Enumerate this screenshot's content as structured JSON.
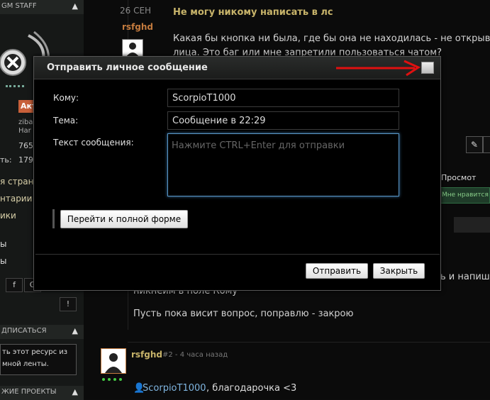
{
  "sidebar": {
    "header1": "GM STAFF",
    "user_short1": "ziba",
    "user_short2": "Har",
    "stat1": "765",
    "stat_label": "ть:",
    "stat2": "179",
    "badge": "Акт",
    "links": [
      "я страниц",
      "нтарии п",
      "ики",
      "ы",
      "ы"
    ],
    "subscribe_header": "ДПИСАТЬСЯ",
    "subscribe_line1": "ть этот ресурс из",
    "subscribe_line2": "мной ленты.",
    "projects_header": "ЖИЕ ПРОЕКТЫ",
    "social": [
      "f",
      "G",
      "●"
    ],
    "excl": "!"
  },
  "post1": {
    "date": "26 СЕН",
    "author": "rsfghd",
    "title": "Не могу никому написать в лс",
    "line1": "Какая бы кнопка ни была, где бы она не находилась - не открывае",
    "line2": "лица. Это баг или мне запретили пользоваться чатом?"
  },
  "post_bg": {
    "right_text": "ь и напиш",
    "text1": "никнеим в поле Кому",
    "text2": "Пусть пока висит вопрос, поправлю - закрою",
    "views_label": "Просмот",
    "likes_label": "Мне нравится +"
  },
  "post2": {
    "author": "rsfghd",
    "meta": "#2 - 4 часа назад",
    "mention": "ScorpioT1000",
    "reply": ", благодарочка <3"
  },
  "dialog": {
    "title": "Отправить личное сообщение",
    "to_label": "Кому:",
    "to_value": "ScorpioT1000",
    "subject_label": "Тема:",
    "subject_value": "Сообщение в 22:29",
    "text_label": "Текст сообщения:",
    "text_placeholder": "Нажмите CTRL+Enter для отправки",
    "full_form_button": "Перейти к полной форме",
    "send_button": "Отправить",
    "close_button": "Закрыть"
  },
  "annotation": {
    "arrow_color": "#e01010"
  }
}
